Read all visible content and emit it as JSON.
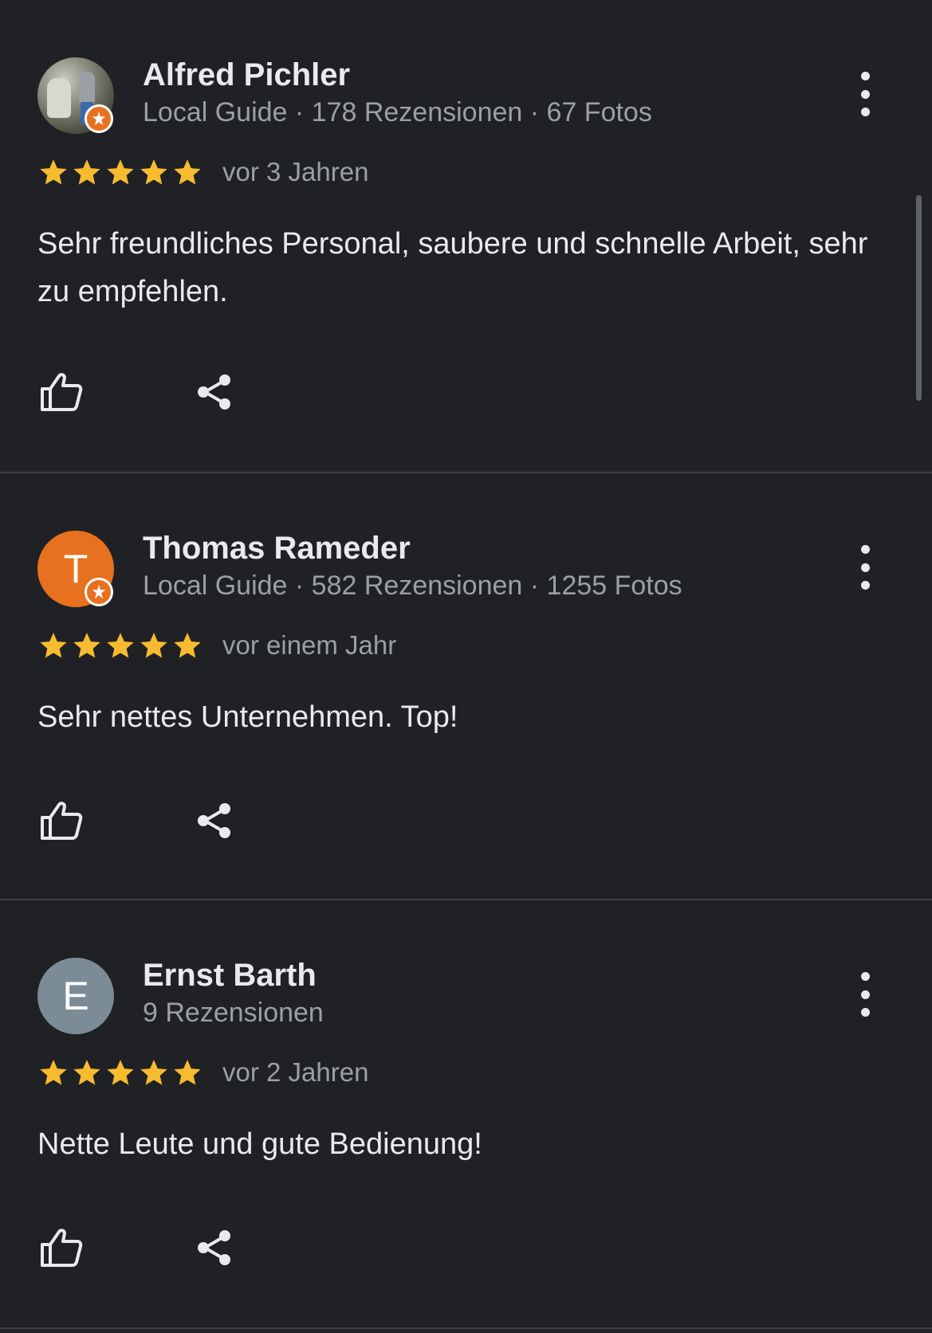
{
  "reviews": [
    {
      "name": "Alfred Pichler",
      "meta": "Local Guide · 178 Rezensionen · 67 Fotos",
      "avatar_type": "photo",
      "local_guide": true,
      "rating": 5,
      "when": "vor 3 Jahren",
      "text": "Sehr freundliches Personal, saubere und schnelle Arbeit, sehr zu empfehlen."
    },
    {
      "name": "Thomas Rameder",
      "meta": "Local Guide · 582 Rezensionen · 1255 Fotos",
      "avatar_type": "letter",
      "avatar_letter": "T",
      "avatar_color": "#e8711f",
      "local_guide": true,
      "rating": 5,
      "when": "vor einem Jahr",
      "text": "Sehr nettes Unternehmen. Top!"
    },
    {
      "name": "Ernst Barth",
      "meta": "9 Rezensionen",
      "avatar_type": "letter",
      "avatar_letter": "E",
      "avatar_color": "#7b8c96",
      "local_guide": false,
      "rating": 5,
      "when": "vor 2 Jahren",
      "text": "Nette Leute und gute Bedienung!"
    }
  ],
  "icons": {
    "like": "thumbs-up-icon",
    "share": "share-icon",
    "menu": "more-vertical-icon",
    "star": "star-icon",
    "badge": "local-guide-badge-icon"
  },
  "colors": {
    "background": "#202124",
    "star": "#f6bb2f",
    "text_primary": "#e8eaed",
    "text_secondary": "#9aa0a6",
    "divider": "#3c4043"
  }
}
